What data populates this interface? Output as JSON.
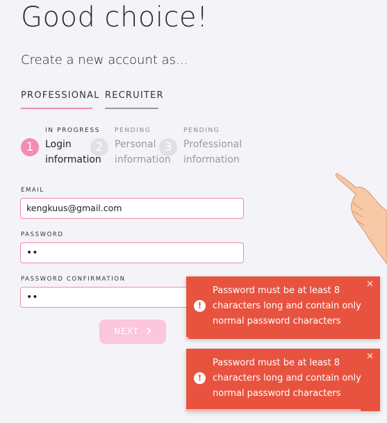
{
  "page": {
    "heading": "Good choice!",
    "subheading": "Create a new account as..."
  },
  "tabs": [
    {
      "label": "PROFESSIONAL",
      "active": true
    },
    {
      "label": "RECRUITER",
      "active": false
    }
  ],
  "steps": [
    {
      "number": "1",
      "status": "IN PROGRESS",
      "title_line1": "Login",
      "title_line2": "information"
    },
    {
      "number": "2",
      "status": "PENDING",
      "title_line1": "Personal",
      "title_line2": "information"
    },
    {
      "number": "3",
      "status": "PENDING",
      "title_line1": "Professional",
      "title_line2": "information"
    }
  ],
  "form": {
    "email_label": "EMAIL",
    "email_value": "kengkuus@gmail.com",
    "password_label": "PASSWORD",
    "password_value": "••",
    "confirm_label": "PASSWORD CONFIRMATION",
    "confirm_value": "••",
    "next_label": "NEXT",
    "next_icon": "chevron-right-icon"
  },
  "toasts": [
    {
      "message": "Password must be at least 8 characters long and contain only normal password characters",
      "icon": "exclamation-circle-icon",
      "close_icon": "close-icon",
      "progress": 0.01
    },
    {
      "message": "Password must be at least 8 characters long and contain only normal password characters",
      "icon": "exclamation-circle-icon",
      "close_icon": "close-icon",
      "progress": 0.9
    }
  ],
  "colors": {
    "accent_pink": "#f08ab3",
    "button_disabled": "#fcc6dd",
    "toast_error": "#e8533f",
    "background": "#f4f3f7"
  }
}
